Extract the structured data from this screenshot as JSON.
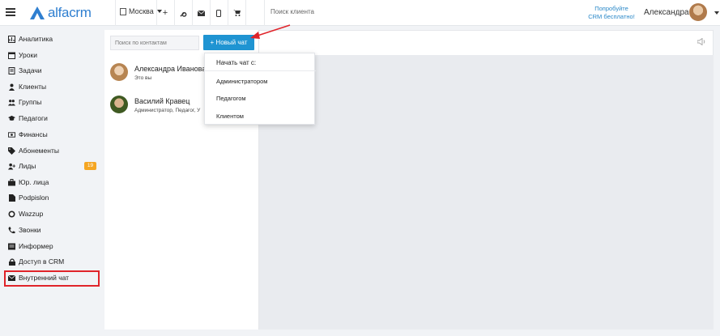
{
  "topbar": {
    "brand": "alfacrm",
    "branch": "Москва",
    "search_placeholder": "Поиск клиента",
    "promo_line1": "Попробуйте",
    "promo_line2": "CRM бесплатно!",
    "user_name": "Александра",
    "icons": [
      "plus-icon",
      "wrench-icon",
      "envelope-icon",
      "phone-icon",
      "cart-icon"
    ]
  },
  "sidebar": {
    "items": [
      {
        "label": "Аналитика",
        "icon": "analytics-icon"
      },
      {
        "label": "Уроки",
        "icon": "calendar-icon"
      },
      {
        "label": "Задачи",
        "icon": "tasks-icon"
      },
      {
        "label": "Клиенты",
        "icon": "user-icon"
      },
      {
        "label": "Группы",
        "icon": "users-icon"
      },
      {
        "label": "Педагоги",
        "icon": "graduation-cap-icon"
      },
      {
        "label": "Финансы",
        "icon": "money-icon"
      },
      {
        "label": "Абонементы",
        "icon": "tag-icon"
      },
      {
        "label": "Лиды",
        "icon": "user-plus-icon"
      },
      {
        "label": "Юр. лица",
        "icon": "briefcase-icon"
      },
      {
        "label": "Podpislon",
        "icon": "document-icon"
      },
      {
        "label": "Wazzup",
        "icon": "whatsapp-icon"
      },
      {
        "label": "Звонки",
        "icon": "phone-icon"
      },
      {
        "label": "Информер",
        "icon": "informer-icon"
      },
      {
        "label": "Доступ в CRM",
        "icon": "lock-icon"
      },
      {
        "label": "Внутренний чат",
        "icon": "envelope-icon"
      }
    ],
    "leads_badge": "19"
  },
  "chat": {
    "contact_search_placeholder": "Поиск по контактам",
    "new_chat_label": "+ Новый чат",
    "contacts": [
      {
        "name": "Александра Иванова",
        "subtitle": "Это вы"
      },
      {
        "name": "Василий Кравец",
        "subtitle": "Администратор, Педагог, У"
      }
    ],
    "dropdown": {
      "header": "Начать чат с:",
      "items": [
        "Администратором",
        "Педагогом",
        "Клиентом"
      ]
    }
  },
  "colors": {
    "accent": "#1f94d2",
    "brand": "#2f7fd0",
    "badge": "#f5a623",
    "annotation": "#e0242a"
  }
}
